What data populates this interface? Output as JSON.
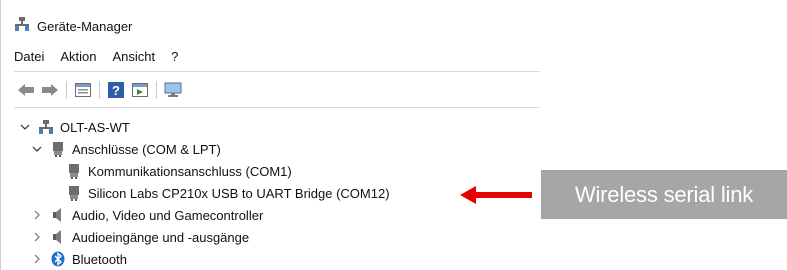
{
  "window": {
    "title": "Geräte-Manager"
  },
  "menu": {
    "items": [
      "Datei",
      "Aktion",
      "Ansicht",
      "?"
    ]
  },
  "tree": {
    "root": {
      "label": "OLT-AS-WT",
      "expanded": true
    },
    "ports": {
      "label": "Anschlüsse (COM & LPT)",
      "expanded": true,
      "children": [
        {
          "label": "Kommunikationsanschluss (COM1)"
        },
        {
          "label": "Silicon Labs CP210x USB to UART Bridge (COM12)"
        }
      ]
    },
    "audio_video": {
      "label": "Audio, Video und Gamecontroller",
      "expanded": false
    },
    "audio_io": {
      "label": "Audioeingänge und -ausgänge",
      "expanded": false
    },
    "bluetooth": {
      "label": "Bluetooth",
      "expanded": false
    }
  },
  "annotation": {
    "text": "Wireless serial link",
    "arrow_color": "#e60000",
    "box_color": "#a6a6a6"
  },
  "icons": {
    "title": "device-manager-icon",
    "toolbar": [
      "back-arrow-icon",
      "forward-arrow-icon",
      "properties-icon",
      "help-icon",
      "update-driver-icon",
      "monitor-icon"
    ],
    "tree": [
      "computer-icon",
      "port-icon",
      "speaker-icon",
      "bluetooth-icon"
    ]
  }
}
